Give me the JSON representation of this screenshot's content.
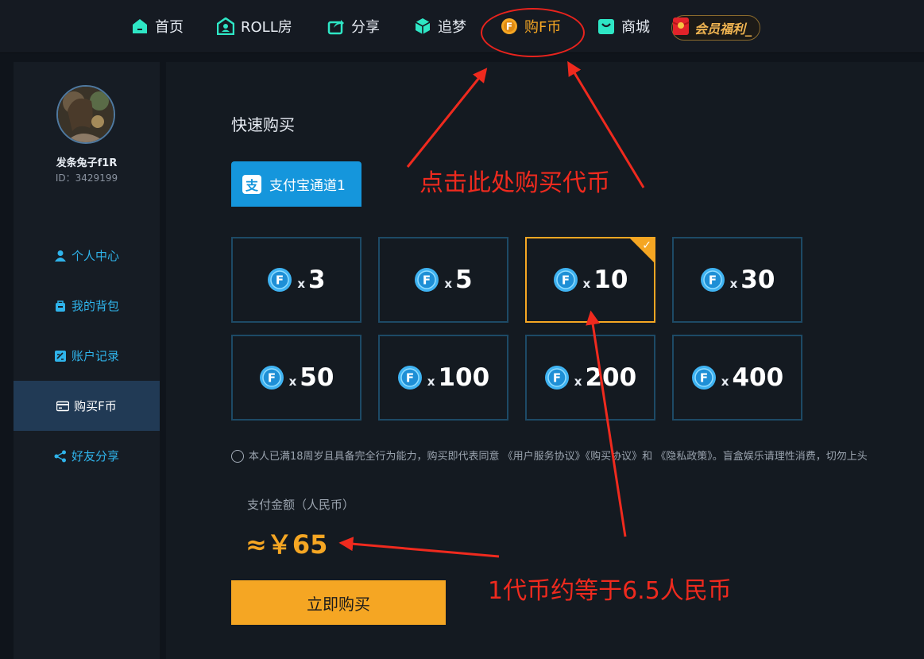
{
  "nav": {
    "items": [
      {
        "label": "首页",
        "icon": "home-icon"
      },
      {
        "label": "ROLL房",
        "icon": "roll-room-icon"
      },
      {
        "label": "分享",
        "icon": "share-icon"
      },
      {
        "label": "追梦",
        "icon": "cube-icon"
      },
      {
        "label": "购F币",
        "icon": "f-coin-icon",
        "active": true
      },
      {
        "label": "商城",
        "icon": "shop-bag-icon"
      }
    ],
    "vip_label": "会员福利_"
  },
  "user": {
    "name": "发条兔子f1R",
    "id_text": "ID：3429199"
  },
  "sidebar": {
    "items": [
      {
        "label": "个人中心",
        "icon": "user-icon"
      },
      {
        "label": "我的背包",
        "icon": "backpack-icon"
      },
      {
        "label": "账户记录",
        "icon": "record-icon"
      },
      {
        "label": "购买F币",
        "icon": "card-icon",
        "active": true
      },
      {
        "label": "好友分享",
        "icon": "share-nodes-icon"
      }
    ]
  },
  "main": {
    "section_title": "快速购买",
    "pay_channel": "支付宝通道1",
    "packages": [
      {
        "x": "x",
        "amount": "3"
      },
      {
        "x": "x",
        "amount": "5"
      },
      {
        "x": "x",
        "amount": "10",
        "selected": true
      },
      {
        "x": "x",
        "amount": "30"
      },
      {
        "x": "x",
        "amount": "50"
      },
      {
        "x": "x",
        "amount": "100"
      },
      {
        "x": "x",
        "amount": "200"
      },
      {
        "x": "x",
        "amount": "400"
      }
    ],
    "agreement_text": "本人已满18周岁且具备完全行为能力，购买即代表同意 《用户服务协议》《购买协议》和 《隐私政策》。盲盒娱乐请理性消费，切勿上头",
    "pay_amount_label": "支付金额（人民币）",
    "pay_amount": "≈￥65",
    "buy_button": "立即购买"
  },
  "annotations": {
    "click_here": "点击此处购买代币",
    "rate_note": "1代币约等于6.5人民币"
  },
  "colors": {
    "accent_orange": "#f5a623",
    "accent_blue": "#2fb3ea",
    "annotation_red": "#ef2a1e"
  }
}
